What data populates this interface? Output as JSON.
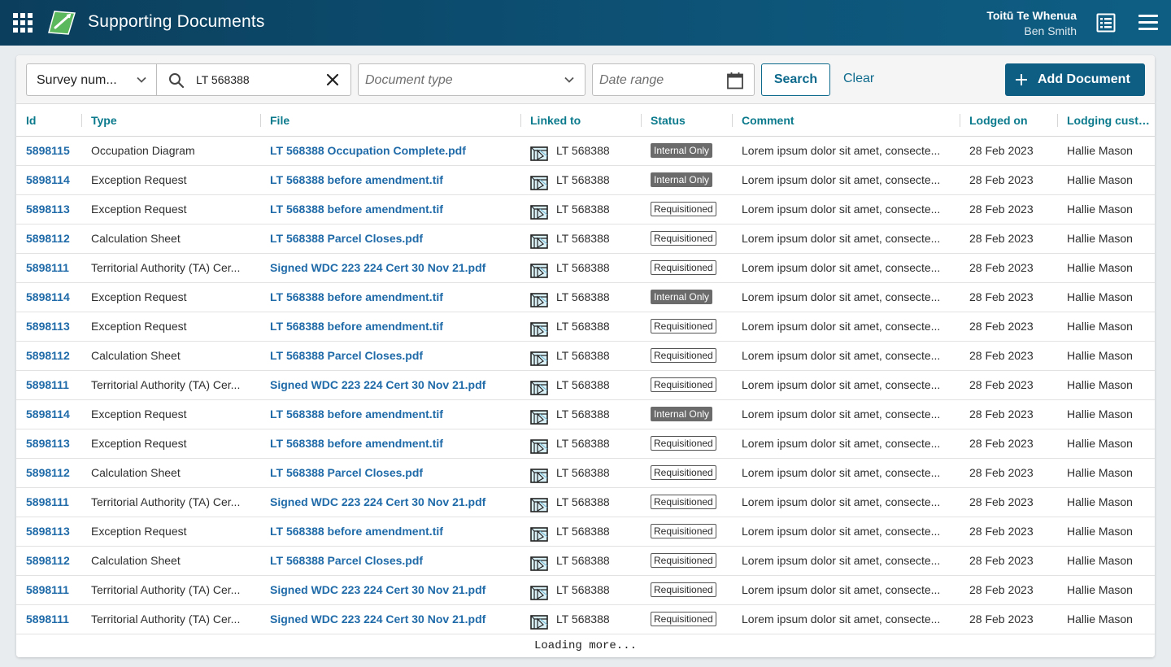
{
  "header": {
    "title": "Supporting Documents",
    "org": "Toitū Te Whenua",
    "user": "Ben Smith"
  },
  "filters": {
    "survey_label": "Survey num...",
    "search_value": "LT 568388",
    "doc_type_placeholder": "Document type",
    "date_placeholder": "Date range",
    "search_button": "Search",
    "clear_link": "Clear",
    "add_button": "Add Document"
  },
  "table": {
    "columns": [
      "Id",
      "Type",
      "File",
      "Linked to",
      "Status",
      "Comment",
      "Lodged on",
      "Lodging custo..."
    ],
    "rows": [
      {
        "id": "5898115",
        "type": "Occupation Diagram",
        "file": "LT 568388 Occupation Complete.pdf",
        "linked": "LT 568388",
        "status": "Internal Only",
        "comment": "Lorem ipsum dolor sit amet, consecte...",
        "lodged": "28 Feb 2023",
        "customer": "Hallie Mason"
      },
      {
        "id": "5898114",
        "type": "Exception Request",
        "file": "LT 568388 before amendment.tif",
        "linked": "LT 568388",
        "status": "Internal Only",
        "comment": "Lorem ipsum dolor sit amet, consecte...",
        "lodged": "28 Feb 2023",
        "customer": "Hallie Mason"
      },
      {
        "id": "5898113",
        "type": "Exception Request",
        "file": "LT 568388 before amendment.tif",
        "linked": "LT 568388",
        "status": "Requisitioned",
        "comment": "Lorem ipsum dolor sit amet, consecte...",
        "lodged": "28 Feb 2023",
        "customer": "Hallie Mason"
      },
      {
        "id": "5898112",
        "type": "Calculation Sheet",
        "file": "LT 568388 Parcel Closes.pdf",
        "linked": "LT 568388",
        "status": "Requisitioned",
        "comment": "Lorem ipsum dolor sit amet, consecte...",
        "lodged": "28 Feb 2023",
        "customer": "Hallie Mason"
      },
      {
        "id": "5898111",
        "type": "Territorial Authority (TA) Cer...",
        "file": "Signed WDC 223 224 Cert 30 Nov 21.pdf",
        "linked": "LT 568388",
        "status": "Requisitioned",
        "comment": "Lorem ipsum dolor sit amet, consecte...",
        "lodged": "28 Feb 2023",
        "customer": "Hallie Mason"
      },
      {
        "id": "5898114",
        "type": "Exception Request",
        "file": "LT 568388 before amendment.tif",
        "linked": "LT 568388",
        "status": "Internal Only",
        "comment": "Lorem ipsum dolor sit amet, consecte...",
        "lodged": "28 Feb 2023",
        "customer": "Hallie Mason"
      },
      {
        "id": "5898113",
        "type": "Exception Request",
        "file": "LT 568388 before amendment.tif",
        "linked": "LT 568388",
        "status": "Requisitioned",
        "comment": "Lorem ipsum dolor sit amet, consecte...",
        "lodged": "28 Feb 2023",
        "customer": "Hallie Mason"
      },
      {
        "id": "5898112",
        "type": "Calculation Sheet",
        "file": "LT 568388 Parcel Closes.pdf",
        "linked": "LT 568388",
        "status": "Requisitioned",
        "comment": "Lorem ipsum dolor sit amet, consecte...",
        "lodged": "28 Feb 2023",
        "customer": "Hallie Mason"
      },
      {
        "id": "5898111",
        "type": "Territorial Authority (TA) Cer...",
        "file": "Signed WDC 223 224 Cert 30 Nov 21.pdf",
        "linked": "LT 568388",
        "status": "Requisitioned",
        "comment": "Lorem ipsum dolor sit amet, consecte...",
        "lodged": "28 Feb 2023",
        "customer": "Hallie Mason"
      },
      {
        "id": "5898114",
        "type": "Exception Request",
        "file": "LT 568388 before amendment.tif",
        "linked": "LT 568388",
        "status": "Internal Only",
        "comment": "Lorem ipsum dolor sit amet, consecte...",
        "lodged": "28 Feb 2023",
        "customer": "Hallie Mason"
      },
      {
        "id": "5898113",
        "type": "Exception Request",
        "file": "LT 568388 before amendment.tif",
        "linked": "LT 568388",
        "status": "Requisitioned",
        "comment": "Lorem ipsum dolor sit amet, consecte...",
        "lodged": "28 Feb 2023",
        "customer": "Hallie Mason"
      },
      {
        "id": "5898112",
        "type": "Calculation Sheet",
        "file": "LT 568388 Parcel Closes.pdf",
        "linked": "LT 568388",
        "status": "Requisitioned",
        "comment": "Lorem ipsum dolor sit amet, consecte...",
        "lodged": "28 Feb 2023",
        "customer": "Hallie Mason"
      },
      {
        "id": "5898111",
        "type": "Territorial Authority (TA) Cer...",
        "file": "Signed WDC 223 224 Cert 30 Nov 21.pdf",
        "linked": "LT 568388",
        "status": "Requisitioned",
        "comment": "Lorem ipsum dolor sit amet, consecte...",
        "lodged": "28 Feb 2023",
        "customer": "Hallie Mason"
      },
      {
        "id": "5898113",
        "type": "Exception Request",
        "file": "LT 568388 before amendment.tif",
        "linked": "LT 568388",
        "status": "Requisitioned",
        "comment": "Lorem ipsum dolor sit amet, consecte...",
        "lodged": "28 Feb 2023",
        "customer": "Hallie Mason"
      },
      {
        "id": "5898112",
        "type": "Calculation Sheet",
        "file": "LT 568388 Parcel Closes.pdf",
        "linked": "LT 568388",
        "status": "Requisitioned",
        "comment": "Lorem ipsum dolor sit amet, consecte...",
        "lodged": "28 Feb 2023",
        "customer": "Hallie Mason"
      },
      {
        "id": "5898111",
        "type": "Territorial Authority (TA) Cer...",
        "file": "Signed WDC 223 224 Cert 30 Nov 21.pdf",
        "linked": "LT 568388",
        "status": "Requisitioned",
        "comment": "Lorem ipsum dolor sit amet, consecte...",
        "lodged": "28 Feb 2023",
        "customer": "Hallie Mason"
      },
      {
        "id": "5898111",
        "type": "Territorial Authority (TA) Cer...",
        "file": "Signed WDC 223 224 Cert 30 Nov 21.pdf",
        "linked": "LT 568388",
        "status": "Requisitioned",
        "comment": "Lorem ipsum dolor sit amet, consecte...",
        "lodged": "28 Feb 2023",
        "customer": "Hallie Mason"
      }
    ]
  },
  "loading_text": "Loading more...",
  "icons": {
    "apps": "apps-grid-icon",
    "logo": "app-logo-icon",
    "documents": "document-list-icon",
    "menu": "hamburger-menu-icon",
    "search": "search-icon",
    "clear": "close-icon",
    "chevron": "chevron-down-icon",
    "calendar": "calendar-icon",
    "plus": "plus-icon",
    "parcel": "parcel-map-icon"
  },
  "colors": {
    "header": "#0d5377",
    "accent": "#0e5e84",
    "link": "#1f6aa8",
    "column_header": "#0b7a8c",
    "internal_badge": "#6b6b6b"
  }
}
